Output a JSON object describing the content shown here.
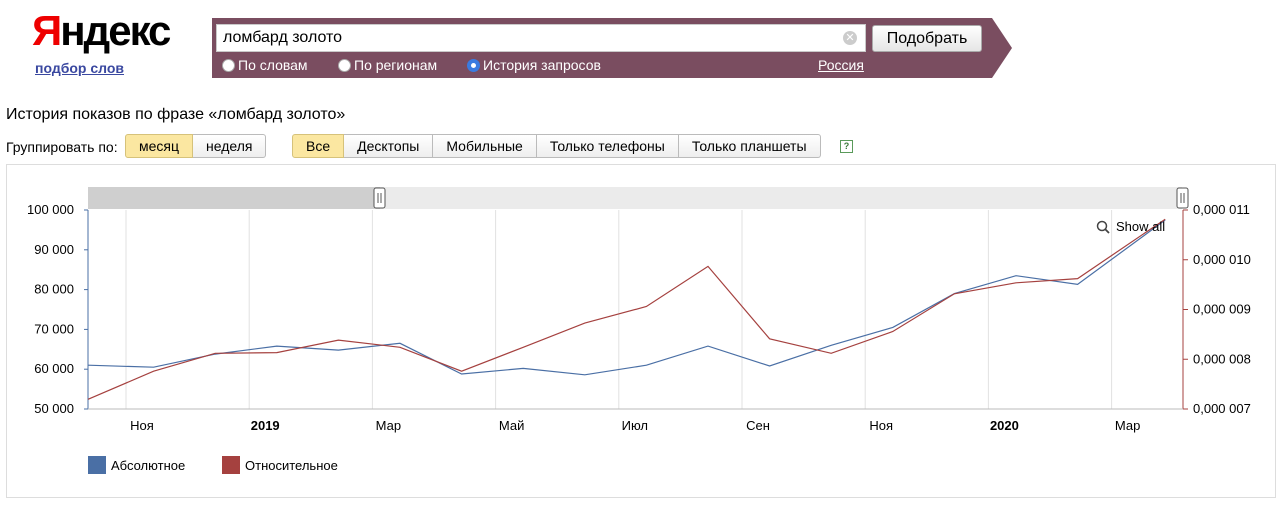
{
  "logo": {
    "first_letter": "Я",
    "rest": "ндекс",
    "subtitle": "подбор слов"
  },
  "search": {
    "value": "ломбард золото",
    "submit_label": "Подобрать"
  },
  "modes": [
    {
      "label": "По словам",
      "selected": false
    },
    {
      "label": "По регионам",
      "selected": false
    },
    {
      "label": "История запросов",
      "selected": true
    }
  ],
  "region": "Россия",
  "heading": "История показов по фразе «ломбард золото»",
  "grouping": {
    "label": "Группировать по:",
    "options": [
      "месяц",
      "неделя"
    ],
    "selected": "месяц"
  },
  "devices": {
    "options": [
      "Все",
      "Десктопы",
      "Мобильные",
      "Только телефоны",
      "Только планшеты"
    ],
    "selected": "Все"
  },
  "help_icon": "?",
  "colors": {
    "accent_bar": "#7a4d60",
    "absolute": "#4a6fa5",
    "relative": "#a5413f"
  },
  "chart_data": {
    "type": "line",
    "x": [
      "2018-10",
      "2018-11",
      "2018-12",
      "2019-01",
      "2019-02",
      "2019-03",
      "2019-04",
      "2019-05",
      "2019-06",
      "2019-07",
      "2019-08",
      "2019-09",
      "2019-10",
      "2019-11",
      "2019-12",
      "2020-01",
      "2020-02",
      "2020-03"
    ],
    "x_tick_labels": [
      {
        "label": "Ноя",
        "bold": false
      },
      {
        "label": "2019",
        "bold": true
      },
      {
        "label": "Мар",
        "bold": false
      },
      {
        "label": "Май",
        "bold": false
      },
      {
        "label": "Июл",
        "bold": false
      },
      {
        "label": "Сен",
        "bold": false
      },
      {
        "label": "Ноя",
        "bold": false
      },
      {
        "label": "2020",
        "bold": true
      },
      {
        "label": "Мар",
        "bold": false
      }
    ],
    "series": [
      {
        "name": "Абсолютное",
        "axis": "left",
        "values": [
          61000,
          60500,
          63800,
          65800,
          64800,
          66500,
          58800,
          60200,
          58600,
          61000,
          65800,
          60800,
          66000,
          70500,
          79000,
          83500,
          81300,
          97500
        ]
      },
      {
        "name": "Относительное",
        "axis": "right",
        "values": [
          0.0071944,
          0.0077593,
          0.0081204,
          0.0081342,
          0.0083843,
          0.0082398,
          0.0077593,
          0.0082398,
          0.0087273,
          0.0090605,
          0.0098656,
          0.008412,
          0.0081204,
          0.0085574,
          0.0093147,
          0.0095375,
          0.0096209,
          0.0108149
        ]
      }
    ],
    "y_left": {
      "ylim": [
        50000,
        100000
      ],
      "ticks": [
        "100 000",
        "90 000",
        "80 000",
        "70 000",
        "60 000",
        "50 000"
      ]
    },
    "y_right": {
      "ylim": [
        0.007,
        0.011
      ],
      "ticks": [
        "0,000 011",
        "0,000 010",
        "0,000 009",
        "0,000 008",
        "0,000 007"
      ]
    },
    "show_all_label": "Show all",
    "legend_placement": "bottom-left",
    "grid": true
  }
}
